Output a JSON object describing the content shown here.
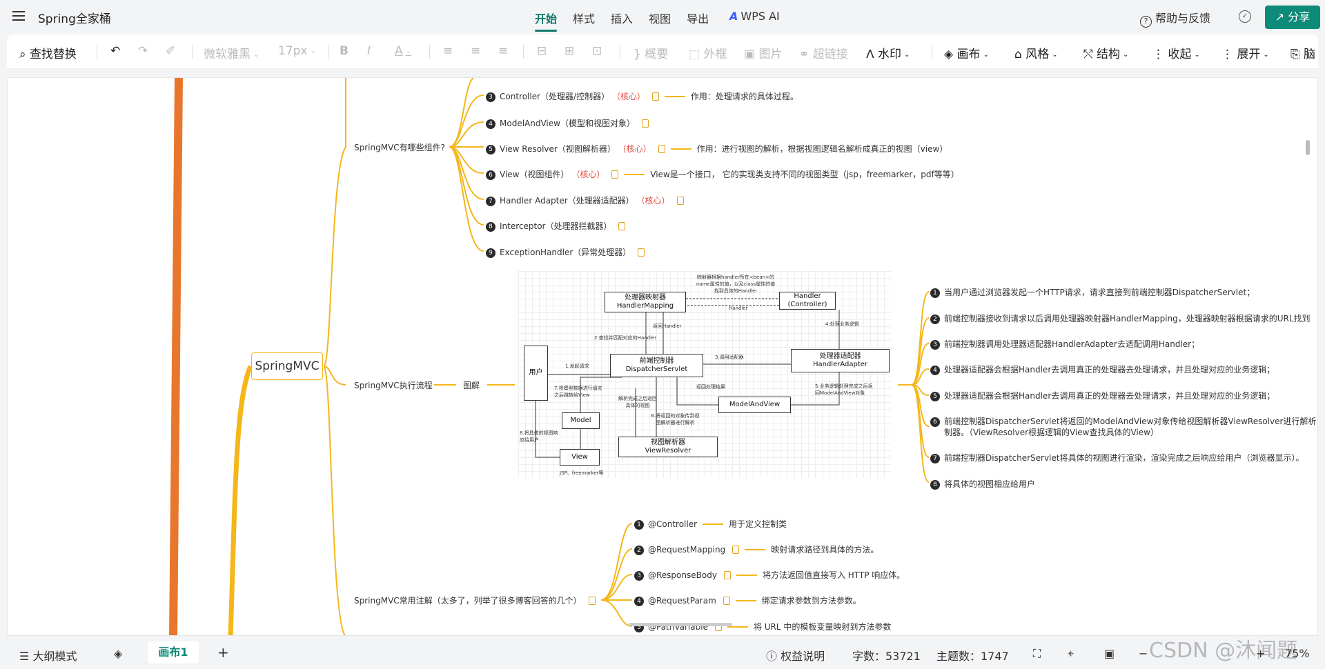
{
  "app": {
    "title": "Spring全家桶"
  },
  "menu": {
    "items": [
      "开始",
      "样式",
      "插入",
      "视图",
      "导出"
    ],
    "ai": "WPS AI"
  },
  "header": {
    "help": "帮助与反馈",
    "share": "分享"
  },
  "toolbar": {
    "find": "查找替换",
    "font": "微软雅黑",
    "size": "17px",
    "summary": "概要",
    "frame": "外框",
    "image": "图片",
    "link": "超链接",
    "watermark": "水印",
    "canvas": "画布",
    "style": "风格",
    "structure": "结构",
    "collapse": "收起",
    "expand": "展开",
    "more": "脑"
  },
  "mindmap": {
    "root": "SpringMVC",
    "components": {
      "label": "SpringMVC有哪些组件?",
      "items": [
        {
          "n": "3",
          "name": "Controller（处理器/控制器）",
          "core": "（核心）",
          "desc": "作用：处理请求的具体过程。"
        },
        {
          "n": "4",
          "name": "ModelAndView（模型和视图对象）",
          "core": "",
          "desc": ""
        },
        {
          "n": "5",
          "name": "View Resolver（视图解析器）",
          "core": "（核心）",
          "desc": "作用：进行视图的解析，根据视图逻辑名解析成真正的视图（view）"
        },
        {
          "n": "6",
          "name": "View（视图组件）",
          "core": "（核心）",
          "desc": "View是一个接口， 它的实现类支持不同的视图类型（jsp，freemarker，pdf等等）"
        },
        {
          "n": "7",
          "name": "Handler Adapter（处理器适配器）",
          "core": "（核心）",
          "desc": ""
        },
        {
          "n": "8",
          "name": "Interceptor（处理器拦截器）",
          "core": "",
          "desc": ""
        },
        {
          "n": "9",
          "name": "ExceptionHandler（异常处理器）",
          "core": "",
          "desc": ""
        }
      ]
    },
    "flow": {
      "label": "SpringMVC执行流程",
      "child": "图解",
      "steps": [
        {
          "n": "1",
          "text": "当用户通过浏览器发起一个HTTP请求，请求直接到前端控制器DispatcherServlet；"
        },
        {
          "n": "2",
          "text": "前端控制器接收到请求以后调用处理器映射器HandlerMapping，处理器映射器根据请求的URL找到"
        },
        {
          "n": "3",
          "text": "前端控制器调用处理器适配器HandlerAdapter去适配调用Handler；"
        },
        {
          "n": "4",
          "text": "处理器适配器会根据Handler去调用真正的处理器去处理请求，并且处理对应的业务逻辑；"
        },
        {
          "n": "5",
          "text": "处理器适配器会根据Handler去调用真正的处理器去处理请求，并且处理对应的业务逻辑；"
        },
        {
          "n": "6",
          "text": "前端控制器DispatcherServlet将返回的ModelAndView对象传给视图解析器ViewResolver进行解析",
          "text2": "制器。（ViewResolver根据逻辑的View查找具体的View）"
        },
        {
          "n": "7",
          "text": "前端控制器DispatcherServlet将具体的视图进行渲染，渲染完成之后响应给用户（浏览器显示）。"
        },
        {
          "n": "8",
          "text": "将具体的视图相应给用户"
        }
      ]
    },
    "annotations": {
      "label": "SpringMVC常用注解（太多了，列举了很多博客回答的几个）",
      "items": [
        {
          "n": "1",
          "name": "@Controller",
          "desc": "用于定义控制类"
        },
        {
          "n": "2",
          "name": "@RequestMapping",
          "desc": "映射请求路径到具体的方法。"
        },
        {
          "n": "3",
          "name": "@ResponseBody",
          "desc": "将方法返回值直接写入 HTTP 响应体。"
        },
        {
          "n": "4",
          "name": "@RequestParam",
          "desc": "绑定请求参数到方法参数。"
        },
        {
          "n": "5",
          "name": "@PathVariable",
          "desc": "将 URL 中的模板变量映射到方法参数"
        }
      ]
    }
  },
  "diagram": {
    "user": "用户",
    "handler_mapping": [
      "处理器映射器",
      "HandlerMapping"
    ],
    "handler": [
      "Handler",
      "(Controller)"
    ],
    "dispatcher": [
      "前端控制器",
      "DispatcherServlet"
    ],
    "adapter": [
      "处理器适配器",
      "HandlerAdapter"
    ],
    "model_and_view": "ModelAndView",
    "model": "Model",
    "view": "View",
    "view_resolver": [
      "视图解析器",
      "ViewResolver"
    ],
    "labels": {
      "top_note": "映射器根据handler所在<bean>的name属性的值，以及class属性的值找到具体的Handler",
      "handler_arrow": "Handler",
      "return_handler": "返回Handler",
      "find": "2.查找并匹配对应的Handler",
      "req": "1.发起请求",
      "call_adapter": "3.调用适配器",
      "biz": "4.处理业务逻辑",
      "biz_done": "5.业务逻辑处理完成之后返回ModelAndView对象",
      "return_result": "返回处理结果",
      "render": "7.将模型数据进行填充之后跳转给View",
      "resolve_done": "解析完成之后返回具体的视图",
      "pass": "6.将返回的对象传到视图解析器进行解析",
      "respond": "8.将具体的视图响应给用户",
      "jsp": "JSP、freemarker等"
    }
  },
  "status": {
    "outline": "大纲模式",
    "tab": "画布1",
    "rights": "权益说明",
    "chars": "字数：53721",
    "topics": "主题数：1747",
    "zoom": "75%"
  },
  "watermark_text": "CSDN @沐闻题"
}
